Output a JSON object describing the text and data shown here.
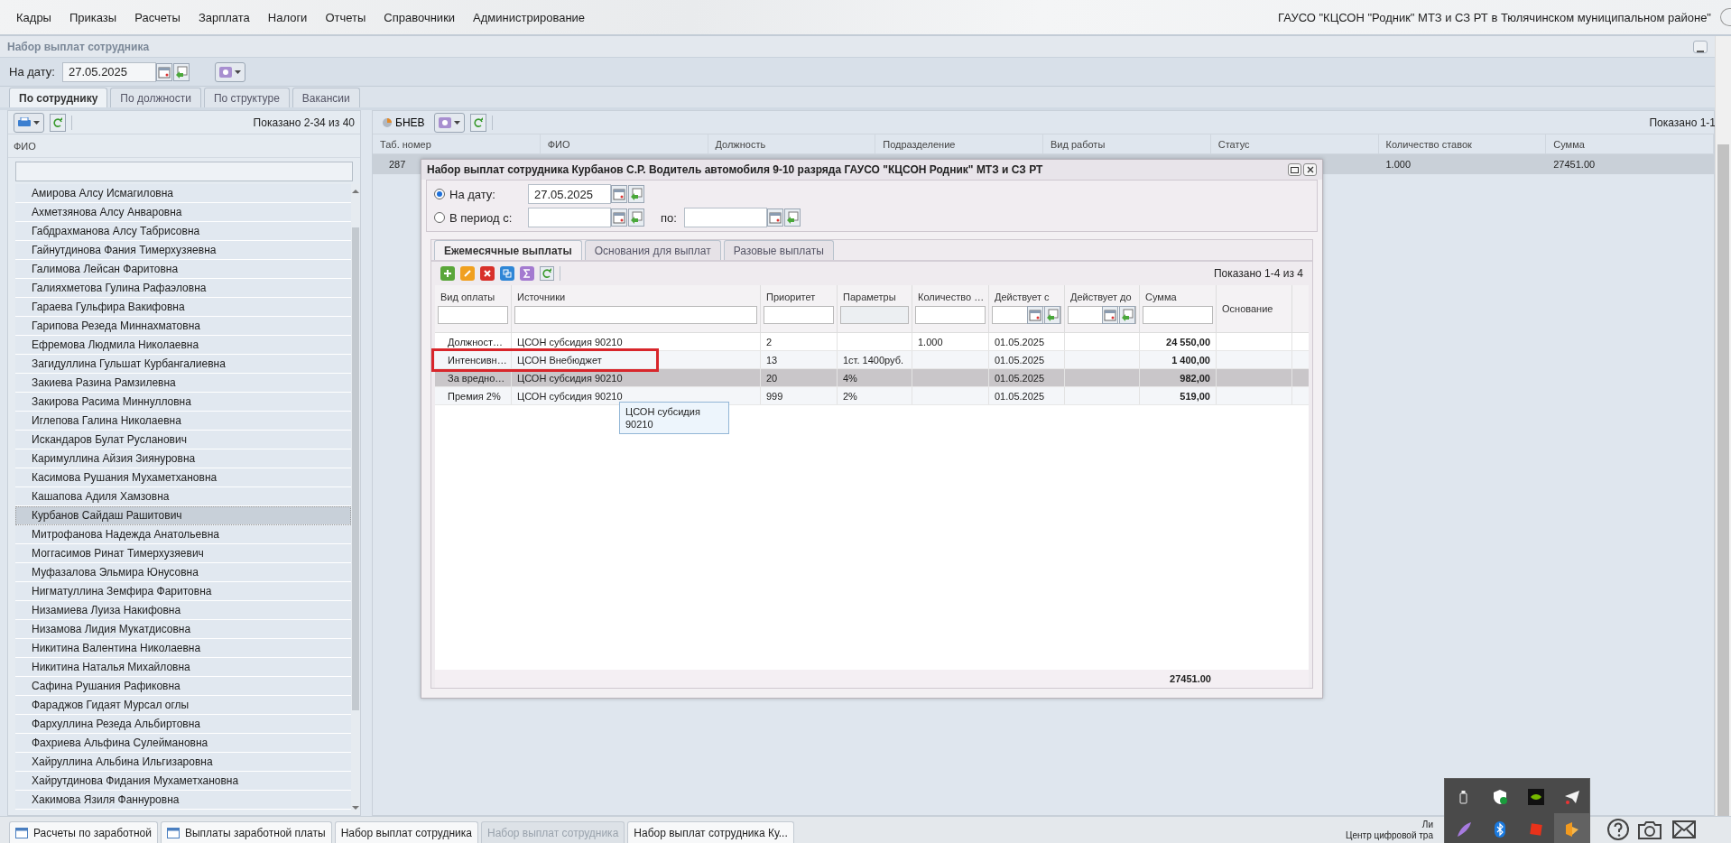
{
  "menu": [
    "Кадры",
    "Приказы",
    "Расчеты",
    "Зарплата",
    "Налоги",
    "Отчеты",
    "Справочники",
    "Администрирование"
  ],
  "organization": "ГАУСО \"КЦСОН \"Родник\" МТЗ и СЗ РТ в Тюлячинском муниципальном районе\"",
  "panel": {
    "title": "Набор выплат сотрудника",
    "date_label": "На дату:",
    "date_value": "27.05.2025"
  },
  "tabs": [
    {
      "label": "По сотруднику",
      "selected": true
    },
    {
      "label": "По должности",
      "selected": false
    },
    {
      "label": "По структуре",
      "selected": false
    },
    {
      "label": "Вакансии",
      "selected": false
    }
  ],
  "employees": {
    "shown": "Показано 2-34 из 40",
    "column": "ФИО",
    "rows": [
      {
        "name": "Амирова Алсу Исмагиловна",
        "selected": false
      },
      {
        "name": "Ахметзянова Алсу Анваровна",
        "selected": false
      },
      {
        "name": "Габдрахманова Алсу Табрисовна",
        "selected": false
      },
      {
        "name": "Гайнутдинова Фания Тимерхузяевна",
        "selected": false
      },
      {
        "name": "Галимова Лейсан Фаритовна",
        "selected": false
      },
      {
        "name": "Галияхметова Гулина Рафаэловна",
        "selected": false
      },
      {
        "name": "Гараева Гульфира Вакифовна",
        "selected": false
      },
      {
        "name": "Гарипова Резеда Миннахматовна",
        "selected": false
      },
      {
        "name": "Ефремова Людмила Николаевна",
        "selected": false
      },
      {
        "name": "Загидуллина Гульшат Курбангалиевна",
        "selected": false
      },
      {
        "name": "Закиева Разина Рамзилевна",
        "selected": false
      },
      {
        "name": "Закирова Расима Миннулловна",
        "selected": false
      },
      {
        "name": "Иглепова Галина Николаевна",
        "selected": false
      },
      {
        "name": "Искандаров Булат Русланович",
        "selected": false
      },
      {
        "name": "Каримуллина Айзия Зиянуровна",
        "selected": false
      },
      {
        "name": "Касимова Рушания Мухаметхановна",
        "selected": false
      },
      {
        "name": "Кашапова Адиля Хамзовна",
        "selected": false
      },
      {
        "name": "Курбанов Сайдаш Рашитович",
        "selected": true
      },
      {
        "name": "Митрофанова Надежда Анатольевна",
        "selected": false
      },
      {
        "name": "Моггасимов Ринат Тимерхузяевич",
        "selected": false
      },
      {
        "name": "Муфазалова Эльмира Юнусовна",
        "selected": false
      },
      {
        "name": "Нигматуллина Земфира Фаритовна",
        "selected": false
      },
      {
        "name": "Низамиева Луиза Накифовна",
        "selected": false
      },
      {
        "name": "Низамова Лидия Мукатдисовна",
        "selected": false
      },
      {
        "name": "Никитина Валентина Николаевна",
        "selected": false
      },
      {
        "name": "Никитина Наталья Михайловна",
        "selected": false
      },
      {
        "name": "Сафина Рушания Рафиковна",
        "selected": false
      },
      {
        "name": "Фараджов Гидаят Мурсал оглы",
        "selected": false
      },
      {
        "name": "Фархуллина Резеда Альбиртовна",
        "selected": false
      },
      {
        "name": "Фахриева Альфина Сулеймановна",
        "selected": false
      },
      {
        "name": "Хайруллина Альбина Ильгизаровна",
        "selected": false
      },
      {
        "name": "Хайрутдинова Фидания Мухаметхановна",
        "selected": false
      },
      {
        "name": "Хакимова Язиля Фаннуровна",
        "selected": false
      }
    ]
  },
  "assignments": {
    "button": "БНЕВ",
    "shown": "Показано 1-1",
    "columns": [
      "Таб. номер",
      "ФИО",
      "Должность",
      "Подразделение",
      "Вид работы",
      "Статус",
      "Количество ставок",
      "Сумма"
    ],
    "rows": [
      {
        "tab_number": "287",
        "rate": "1.000",
        "sum": "27451.00",
        "selected": true
      }
    ]
  },
  "dialog": {
    "title": "Набор выплат сотрудника Курбанов С.Р. Водитель автомобиля 9-10 разряда ГАУСО \"КЦСОН Родник\" МТЗ и СЗ РТ",
    "date_modes": [
      {
        "label": "На дату:",
        "selected": true
      },
      {
        "label": "В период с:",
        "selected": false
      }
    ],
    "date_value": "27.05.2025",
    "period_to_label": "по:",
    "tabs": [
      {
        "label": "Ежемесячные выплаты",
        "selected": true
      },
      {
        "label": "Основания для выплат",
        "selected": false
      },
      {
        "label": "Разовые выплаты",
        "selected": false
      }
    ],
    "shown": "Показано 1-4 из 4",
    "columns": [
      {
        "label": "Вид оплаты",
        "kind": "text"
      },
      {
        "label": "Источники",
        "kind": "text"
      },
      {
        "label": "Приоритет",
        "kind": "text"
      },
      {
        "label": "Параметры",
        "kind": "disabled"
      },
      {
        "label": "Количество …",
        "kind": "text"
      },
      {
        "label": "Действует с",
        "kind": "date"
      },
      {
        "label": "Действует до",
        "kind": "date"
      },
      {
        "label": "Сумма",
        "kind": "amount"
      },
      {
        "label": "Основание",
        "kind": "plain"
      }
    ],
    "rows": [
      {
        "cells": [
          "Должност…",
          "ЦСОН субсидия 90210",
          "2",
          null,
          "1.000",
          "01.05.2025",
          null,
          "24 550,00",
          null
        ],
        "selected": false,
        "highlighted": false
      },
      {
        "cells": [
          "Интенсивн…",
          "ЦСОН Внебюджет",
          "13",
          "1ст. 1400руб.",
          null,
          "01.05.2025",
          null,
          "1 400,00",
          null
        ],
        "selected": false,
        "highlighted": true
      },
      {
        "cells": [
          "За вредно…",
          "ЦСОН субсидия 90210",
          "20",
          "4%",
          null,
          "01.05.2025",
          null,
          "982,00",
          null
        ],
        "selected": true,
        "highlighted": false
      },
      {
        "cells": [
          "Премия 2%",
          "ЦСОН субсидия 90210",
          "999",
          "2%",
          null,
          "01.05.2025",
          null,
          "519,00",
          null
        ],
        "selected": false,
        "highlighted": false
      }
    ],
    "total": "27451.00",
    "tooltip": "ЦСОН субсидия 90210"
  },
  "taskbar": [
    {
      "label": "Расчеты по заработной",
      "icon": true,
      "disabled": false
    },
    {
      "label": "Выплаты заработной платы",
      "icon": true,
      "disabled": false
    },
    {
      "label": "Набор выплат сотрудника",
      "icon": false,
      "disabled": false
    },
    {
      "label": "Набор выплат сотрудника",
      "icon": false,
      "disabled": true
    },
    {
      "label": "Набор выплат сотрудника Ку...",
      "icon": false,
      "disabled": false
    }
  ],
  "status": [
    "Ли",
    "Центр цифровой тра"
  ]
}
